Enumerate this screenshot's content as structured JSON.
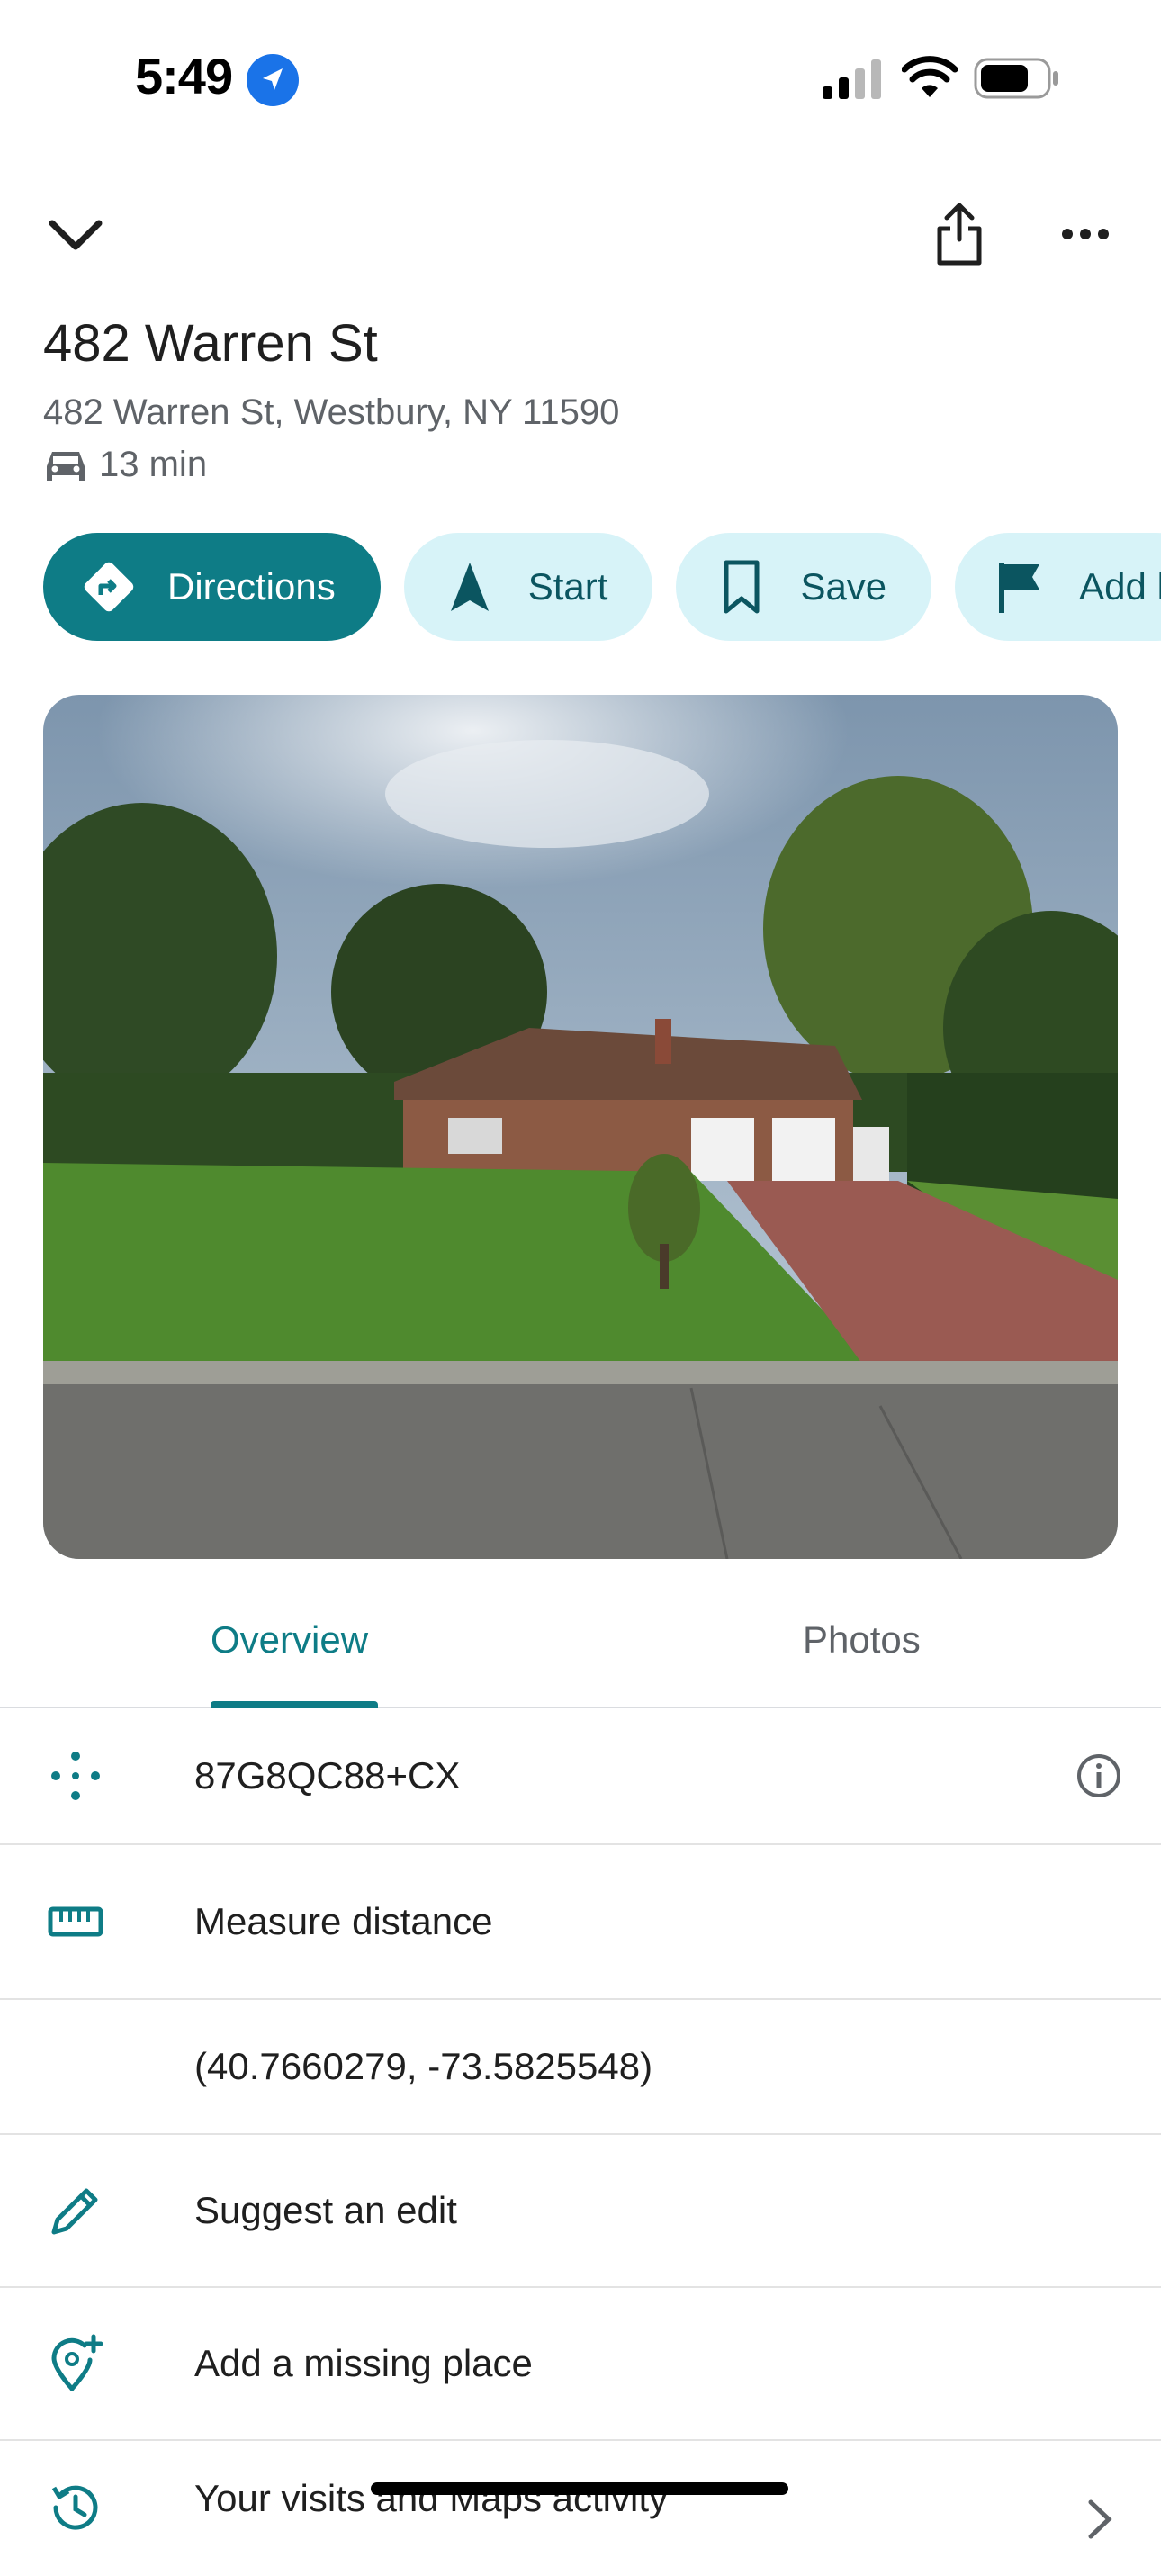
{
  "status_bar": {
    "time": "5:49",
    "icons": [
      "location-arrow-icon",
      "cellular-signal-icon",
      "wifi-icon",
      "battery-icon"
    ]
  },
  "header": {
    "icons": [
      "chevron-down-icon",
      "share-icon",
      "more-icon"
    ]
  },
  "place": {
    "title": "482 Warren St",
    "address": "482 Warren St, Westbury, NY 11590",
    "drive_time": "13 min",
    "drive_icon": "car-icon"
  },
  "actions": [
    {
      "label": "Directions",
      "icon": "directions-icon",
      "style": "primary"
    },
    {
      "label": "Start",
      "icon": "navigation-arrow-icon",
      "style": "secondary"
    },
    {
      "label": "Save",
      "icon": "bookmark-icon",
      "style": "secondary"
    },
    {
      "label": "Add l",
      "icon": "flag-icon",
      "style": "secondary"
    }
  ],
  "tabs": [
    {
      "label": "Overview",
      "active": true
    },
    {
      "label": "Photos",
      "active": false
    }
  ],
  "rows": [
    {
      "text": "87G8QC88+CX",
      "icon": "plus-code-icon",
      "trailing": "info-icon"
    },
    {
      "text": "Measure distance",
      "icon": "ruler-icon"
    },
    {
      "text": "(40.7660279, -73.5825548)",
      "icon": ""
    },
    {
      "text": "Suggest an edit",
      "icon": "pencil-icon"
    },
    {
      "text": "Add a missing place",
      "icon": "add-location-icon"
    },
    {
      "text": "Your visits and Maps activity",
      "icon": "history-icon",
      "trailing": "chevron-right-icon"
    }
  ],
  "colors": {
    "accent": "#0e7c86",
    "chip_secondary_bg": "#d7f3f8",
    "secondary_text": "#5f6368"
  }
}
